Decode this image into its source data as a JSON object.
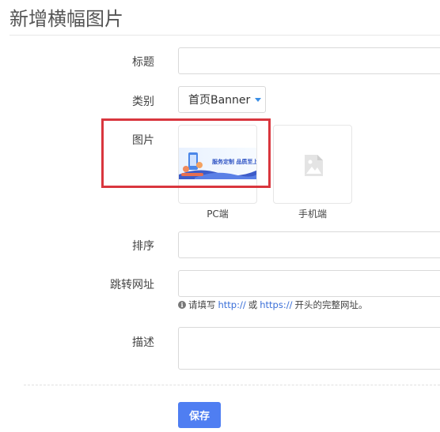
{
  "page": {
    "title": "新增横幅图片"
  },
  "form": {
    "title_label": "标题",
    "category_label": "类别",
    "category_value": "首页Banner",
    "image_label": "图片",
    "pc_caption": "PC端",
    "mobile_caption": "手机端",
    "banner_text": "服务定制 品质至上",
    "sort_label": "排序",
    "url_label": "跳转网址",
    "hint": {
      "prefix": "请填写",
      "http": "http://",
      "or": "或",
      "https": "https://",
      "suffix": "开头的完整网址。"
    },
    "desc_label": "描述",
    "save_label": "保存"
  },
  "colors": {
    "accent": "#4f7ef2",
    "highlight_border": "#d9363e",
    "link": "#3a6fd8"
  },
  "icons": {
    "mobile_placeholder": "image-placeholder-icon",
    "hint": "info-icon",
    "select": "caret-down-icon"
  }
}
